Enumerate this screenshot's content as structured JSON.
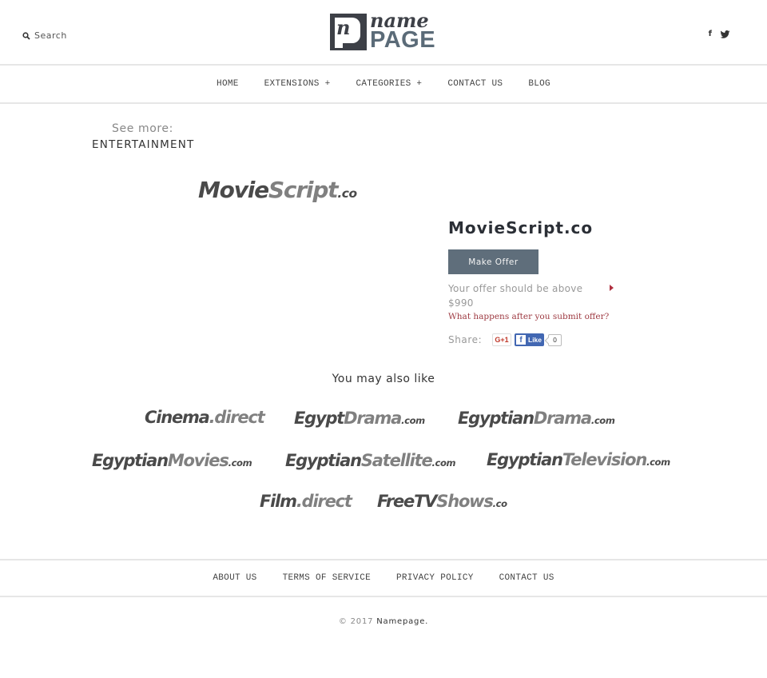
{
  "header": {
    "search_label": "Search",
    "logo": {
      "small": "n",
      "top": "name",
      "bottom": "PAGE"
    },
    "social": [
      {
        "name": "facebook",
        "glyph": "f"
      },
      {
        "name": "twitter",
        "glyph": "🐦"
      }
    ]
  },
  "nav": {
    "items": [
      {
        "label": "HOME"
      },
      {
        "label": "EXTENSIONS +"
      },
      {
        "label": "CATEGORIES +"
      },
      {
        "label": "CONTACT US"
      },
      {
        "label": "BLOG"
      }
    ]
  },
  "breadcrumb": {
    "see_more": "See more:",
    "category": "ENTERTAINMENT"
  },
  "product": {
    "logo": {
      "part1": "Movie",
      "part2": "Script",
      "tld": ".co"
    },
    "domain": "MovieScript.co",
    "make_offer": "Make Offer",
    "offer_note": "Your offer should be above $990",
    "what_happens": "What happens after you submit offer?",
    "share_label": "Share:",
    "gplus_label": "G+1",
    "fb_like_label": "Like",
    "fb_count": "0",
    "colors": {
      "button": "#5f6e7b",
      "link": "#9e3a42",
      "fb": "#4267b2"
    }
  },
  "related": {
    "title": "You may also like",
    "items": [
      {
        "part1": "Cinema",
        "part2": ".direct",
        "tld": ""
      },
      {
        "part1": "Egypt",
        "part2": "Drama",
        "tld": ".com"
      },
      {
        "part1": "Egyptian",
        "part2": "Drama",
        "tld": ".com"
      },
      {
        "part1": "Egyptian",
        "part2": "Movies",
        "tld": ".com"
      },
      {
        "part1": "Egyptian",
        "part2": "Satellite",
        "tld": ".com"
      },
      {
        "part1": "Egyptian",
        "part2": "Television",
        "tld": ".com"
      },
      {
        "part1": "Film",
        "part2": ".direct",
        "tld": ""
      },
      {
        "part1": "FreeTV",
        "part2": "Shows",
        "tld": ".co"
      }
    ]
  },
  "footer": {
    "links": [
      {
        "label": "ABOUT US"
      },
      {
        "label": "TERMS OF SERVICE"
      },
      {
        "label": "PRIVACY POLICY"
      },
      {
        "label": "CONTACT US"
      }
    ],
    "copyright_year": "© 2017",
    "copyright_name": "Namepage."
  }
}
